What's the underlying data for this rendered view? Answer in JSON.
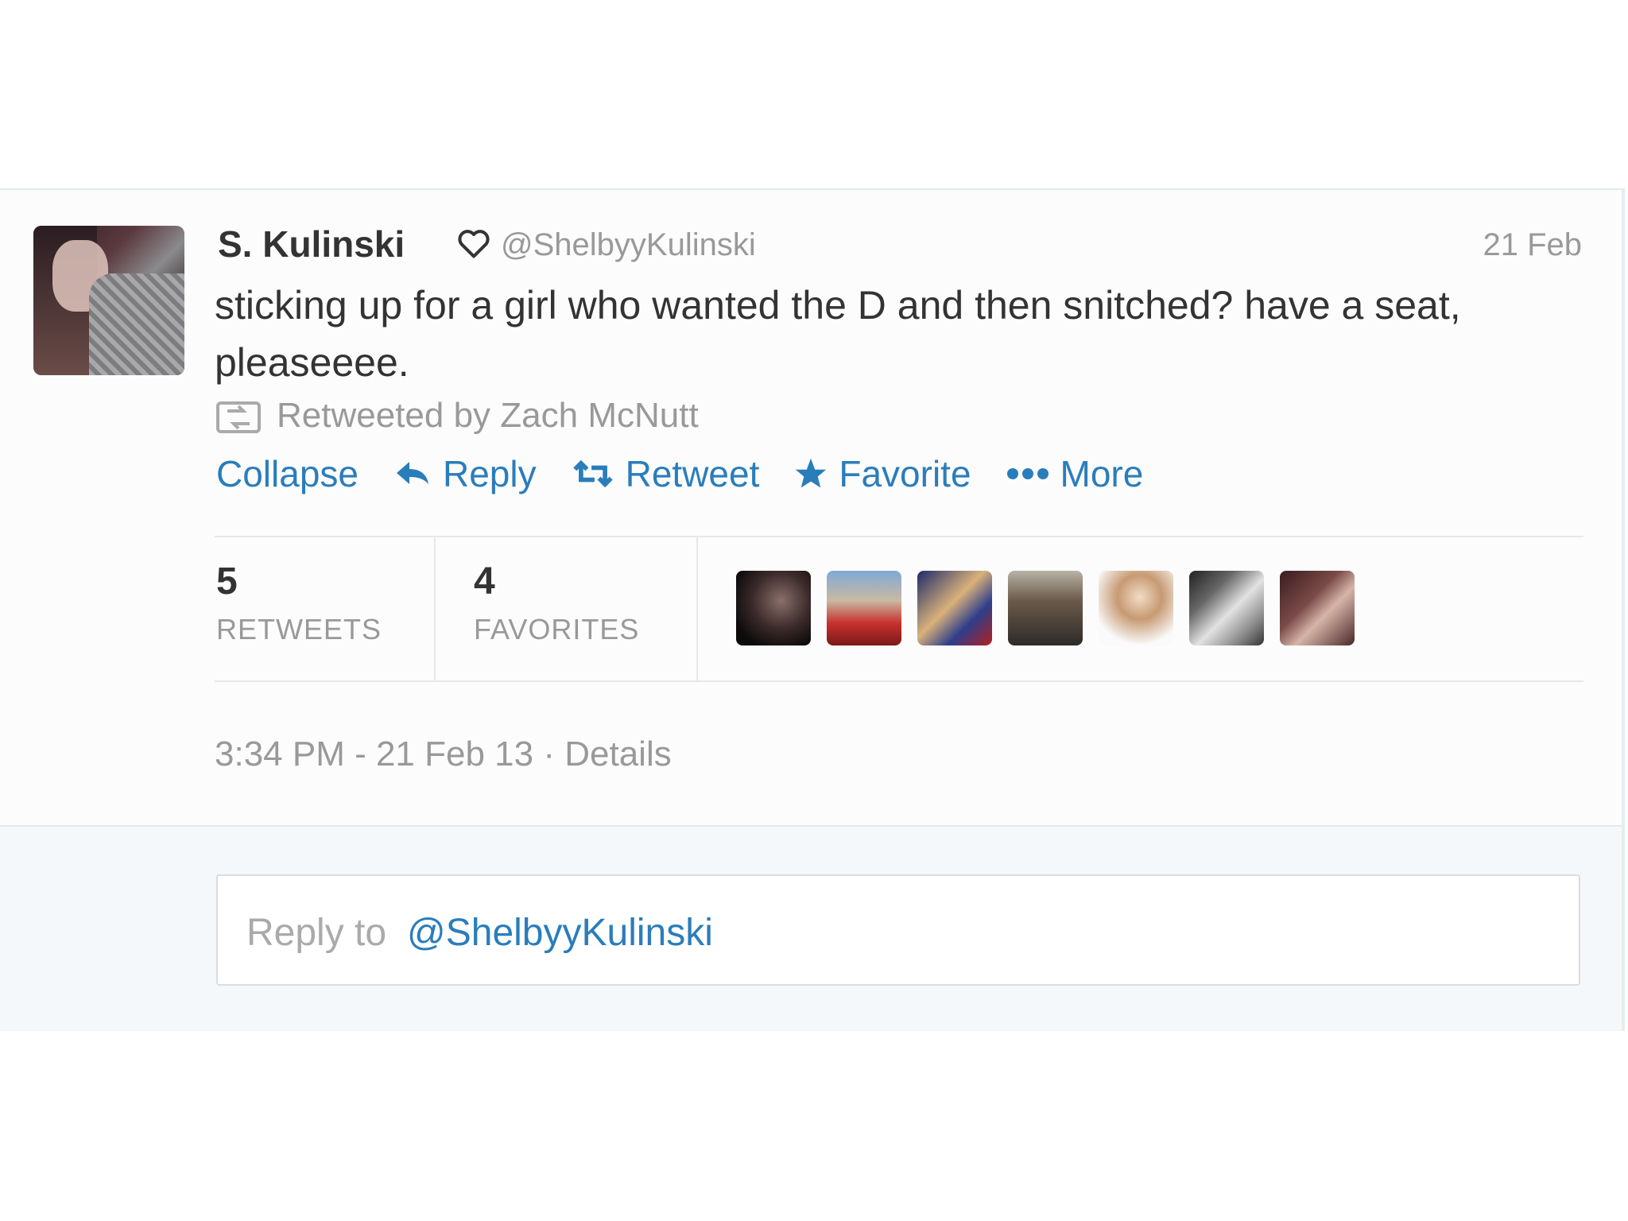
{
  "tweet": {
    "display_name": "S. Kulinski",
    "handle": "@ShelbyyKulinski",
    "date_short": "21 Feb",
    "text": "sticking up for a girl who wanted the D and then snitched? have a seat, pleaseeee.",
    "retweeted_by": "Retweeted by Zach McNutt",
    "timestamp": "3:34 PM - 21 Feb 13",
    "separator": " · ",
    "details_link": "Details"
  },
  "actions": {
    "collapse": "Collapse",
    "reply": "Reply",
    "retweet": "Retweet",
    "favorite": "Favorite",
    "more": "More"
  },
  "stats": {
    "retweets_count": "5",
    "retweets_label": "RETWEETS",
    "favorites_count": "4",
    "favorites_label": "FAVORITES"
  },
  "reply_box": {
    "prefix": "Reply to",
    "handle": "@ShelbyyKulinski"
  },
  "colors": {
    "link": "#2a7dbb",
    "muted": "#999999",
    "text": "#333333"
  },
  "icons": [
    "heart-icon",
    "retweeted-icon",
    "reply-arrow-icon",
    "retweet-icon",
    "star-icon",
    "more-dots-icon"
  ]
}
